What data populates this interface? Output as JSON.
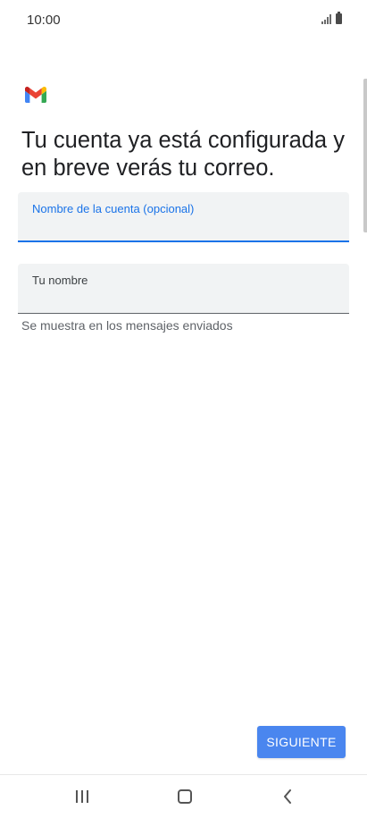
{
  "status_bar": {
    "time": "10:00",
    "icons": [
      "signal-icon",
      "battery-icon"
    ]
  },
  "app": {
    "logo": "gmail-logo-icon",
    "brand_colors": {
      "red": "#ea4335",
      "blue": "#4285f4",
      "green": "#34a853",
      "yellow": "#fbbc04"
    }
  },
  "headline": "Tu cuenta ya está configurada y en breve verás tu correo.",
  "form": {
    "account_name": {
      "label": "Nombre de la cuenta (opcional)",
      "value": ""
    },
    "your_name": {
      "label": "Tu nombre",
      "value": "",
      "helper": "Se muestra en los mensajes enviados"
    }
  },
  "actions": {
    "next_label": "SIGUIENTE",
    "next_color": "#4a86ef"
  },
  "nav_bar": {
    "buttons": [
      "recents-icon",
      "home-icon",
      "back-icon"
    ]
  }
}
